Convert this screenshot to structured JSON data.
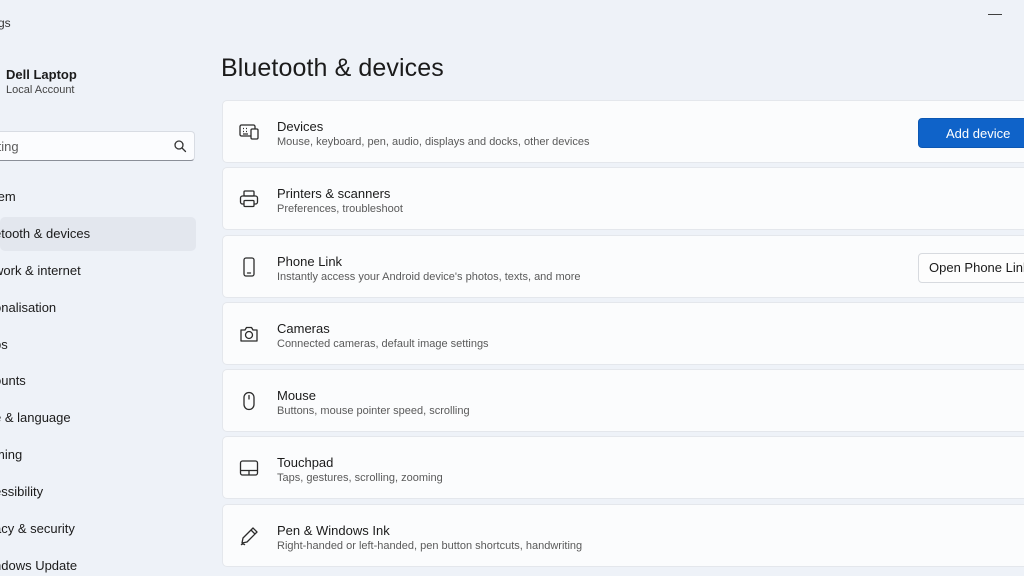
{
  "window": {
    "app_title_fragment": "gs",
    "minimize_glyph": "—"
  },
  "sidebar": {
    "profile": {
      "name": "Dell Laptop",
      "account_type": "Local Account"
    },
    "search": {
      "placeholder": "tting",
      "icon": "search-icon"
    },
    "items": [
      {
        "label": "tem",
        "active": false
      },
      {
        "label": "etooth & devices",
        "active": true
      },
      {
        "label": "work & internet",
        "active": false
      },
      {
        "label": "onalisation",
        "active": false
      },
      {
        "label": "ps",
        "active": false
      },
      {
        "label": "ounts",
        "active": false
      },
      {
        "label": "e & language",
        "active": false
      },
      {
        "label": "ming",
        "active": false
      },
      {
        "label": "essibility",
        "active": false
      },
      {
        "label": "acy & security",
        "active": false
      },
      {
        "label": "ndows Update",
        "active": false
      }
    ]
  },
  "main": {
    "title": "Bluetooth & devices",
    "cards": [
      {
        "title": "Devices",
        "description": "Mouse, keyboard, pen, audio, displays and docks, other devices",
        "icon": "devices-icon",
        "button": "Add device"
      },
      {
        "title": "Printers & scanners",
        "description": "Preferences, troubleshoot",
        "icon": "printer-icon"
      },
      {
        "title": "Phone Link",
        "description": "Instantly access your Android device's photos, texts, and more",
        "icon": "phone-icon",
        "button": "Open Phone Link"
      },
      {
        "title": "Cameras",
        "description": "Connected cameras, default image settings",
        "icon": "camera-icon"
      },
      {
        "title": "Mouse",
        "description": "Buttons, mouse pointer speed, scrolling",
        "icon": "mouse-icon"
      },
      {
        "title": "Touchpad",
        "description": "Taps, gestures, scrolling, zooming",
        "icon": "touchpad-icon"
      },
      {
        "title": "Pen & Windows Ink",
        "description": "Right-handed or left-handed, pen button shortcuts, handwriting",
        "icon": "pen-icon"
      }
    ]
  },
  "colors": {
    "accent": "#0f63c9",
    "background": "#eef2f8",
    "card": "#fbfcfd",
    "active_nav": "#e3e7ee"
  }
}
